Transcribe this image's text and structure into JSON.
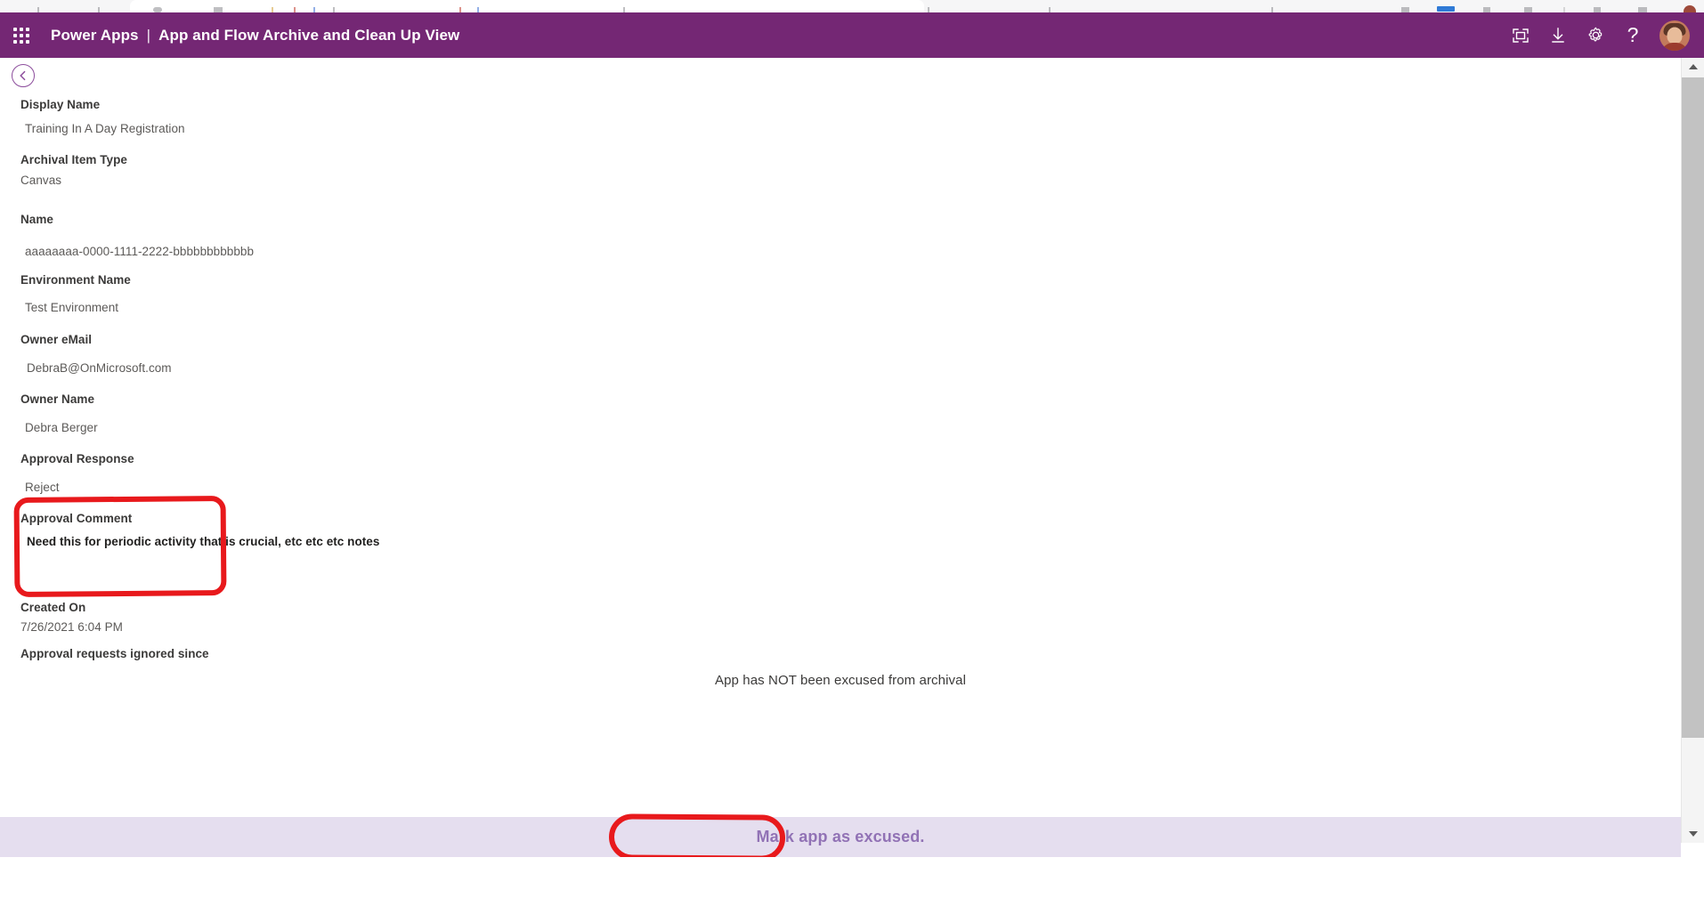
{
  "browser": {
    "chrome_visible": true
  },
  "header": {
    "app_launcher_icon": "waffle-grid-icon",
    "brand": "Power Apps",
    "separator": "|",
    "title": "App and Flow Archive and Clean Up View",
    "accent_color": "#742774",
    "actions": [
      {
        "name": "fullscreen-icon",
        "label": "Full screen"
      },
      {
        "name": "download-icon",
        "label": "Download"
      },
      {
        "name": "gear-icon",
        "label": "Settings"
      },
      {
        "name": "help-icon",
        "label": "?"
      }
    ],
    "avatar_alt": "User account"
  },
  "nav": {
    "back_icon": "chevron-left-icon",
    "back_label": "Back"
  },
  "form": {
    "fields": [
      {
        "label": "Display Name",
        "value": "Training In A Day Registration"
      },
      {
        "label": "Archival Item Type",
        "value": "Canvas"
      },
      {
        "label": "Name",
        "value": "aaaaaaaa-0000-1111-2222-bbbbbbbbbbbb"
      },
      {
        "label": "Environment Name",
        "value": "Test Environment"
      },
      {
        "label": "Owner eMail",
        "value": "DebraB@OnMicrosoft.com"
      },
      {
        "label": "Owner Name",
        "value": "Debra Berger"
      },
      {
        "label": "Approval Response",
        "value": "Reject"
      },
      {
        "label": "Approval Comment",
        "value": "Need this for periodic activity that is crucial, etc etc etc notes"
      },
      {
        "label": "Created On",
        "value": "7/26/2021 6:04 PM"
      },
      {
        "label": "Approval requests ignored since",
        "value": ""
      }
    ]
  },
  "status": {
    "message": "App has NOT been excused from archival"
  },
  "action_bar": {
    "background_color": "#E5DEEF",
    "excuse_button_label": "Mark app as excused.",
    "excuse_button_color": "#9172B5"
  },
  "annotations": {
    "color": "#E8191C",
    "regions": [
      {
        "name": "approval-comment-highlight",
        "target": "Approval Comment"
      },
      {
        "name": "mark-excused-highlight",
        "target": "Mark app as excused."
      }
    ]
  },
  "scrollbar": {
    "up_icon": "caret-up-icon",
    "down_icon": "caret-down-icon",
    "orientation": "vertical"
  }
}
